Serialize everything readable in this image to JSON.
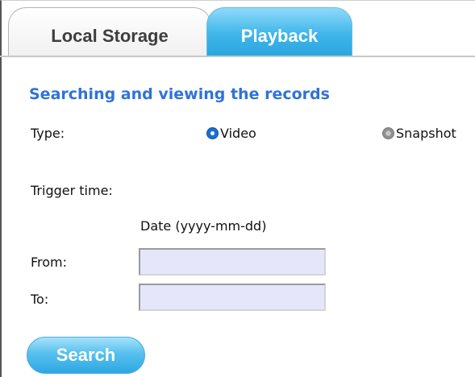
{
  "tabs": {
    "local_storage": "Local Storage",
    "playback": "Playback",
    "active": "playback"
  },
  "section": {
    "title": "Searching and viewing the records"
  },
  "type": {
    "label": "Type:",
    "options": [
      {
        "label": "Video",
        "checked": true
      },
      {
        "label": "Snapshot",
        "checked": false
      }
    ]
  },
  "trigger": {
    "label": "Trigger time:",
    "date_header": "Date (yyyy-mm-dd)",
    "from_label": "From:",
    "from_value": "",
    "to_label": "To:",
    "to_value": ""
  },
  "search_button": "Search",
  "colors": {
    "accent_blue": "#2aa6e0",
    "title_blue": "#2f73d6",
    "input_bg": "#e6e6fb"
  }
}
